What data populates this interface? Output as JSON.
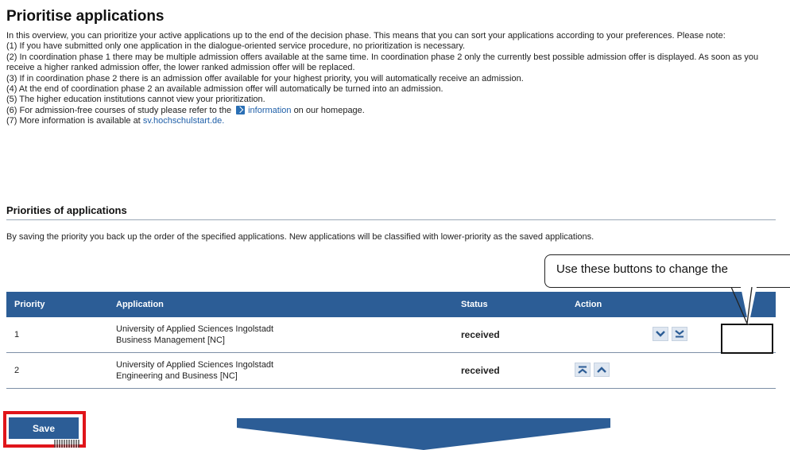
{
  "page_title": "Prioritise applications",
  "intro": {
    "para1": "In this overview, you can prioritize your active applications up to the end of the decision phase. This means that you can sort your applications according to your preferences. Please note:",
    "item1": "(1) If you have submitted only one application in the dialogue-oriented service procedure, no prioritization is necessary.",
    "item2": "(2) In coordination phase 1 there may be multiple admission offers available at the same time. In coordination phase 2 only the currently best possible admission offer is displayed. As soon as you receive a higher ranked admission offer, the lower ranked admission offer will be replaced.",
    "item3": "(3) If in coordination phase 2 there is an admission offer available for your highest priority, you will automatically receive an admission.",
    "item4": "(4) At the end of coordination phase 2 an available admission offer will automatically be turned into an admission.",
    "item5": "(5) The higher education institutions cannot view your prioritization.",
    "item6_before": "(6) For admission-free courses of study please refer to the",
    "item6_link": "information",
    "item6_after": "on our homepage.",
    "item7_before": "(7) More information is available at",
    "item7_link": "sv.hochschulstart.de."
  },
  "section": {
    "title": "Priorities of applications",
    "description": "By saving the priority you back up the order of the specified applications. New applications will be classified with lower-priority as the saved applications."
  },
  "callout_text": "Use these buttons to change the",
  "table": {
    "headers": [
      "Priority",
      "Application",
      "Status",
      "Action"
    ],
    "rows": [
      {
        "priority": "1",
        "university": "University of Applied Sciences Ingolstadt",
        "course": "Business Management [NC]",
        "status": "received",
        "actions": [
          "move-down-icon",
          "move-to-bottom-icon"
        ]
      },
      {
        "priority": "2",
        "university": "University of Applied Sciences Ingolstadt",
        "course": "Engineering and Business [NC]",
        "status": "received",
        "actions": [
          "move-to-top-icon",
          "move-up-icon"
        ]
      }
    ]
  },
  "save_label": "Save",
  "colors": {
    "header_blue": "#2c5d96",
    "link_blue": "#1f5fa8",
    "highlight_red": "#e0151a",
    "arrow_blue": "#2c5d96"
  }
}
